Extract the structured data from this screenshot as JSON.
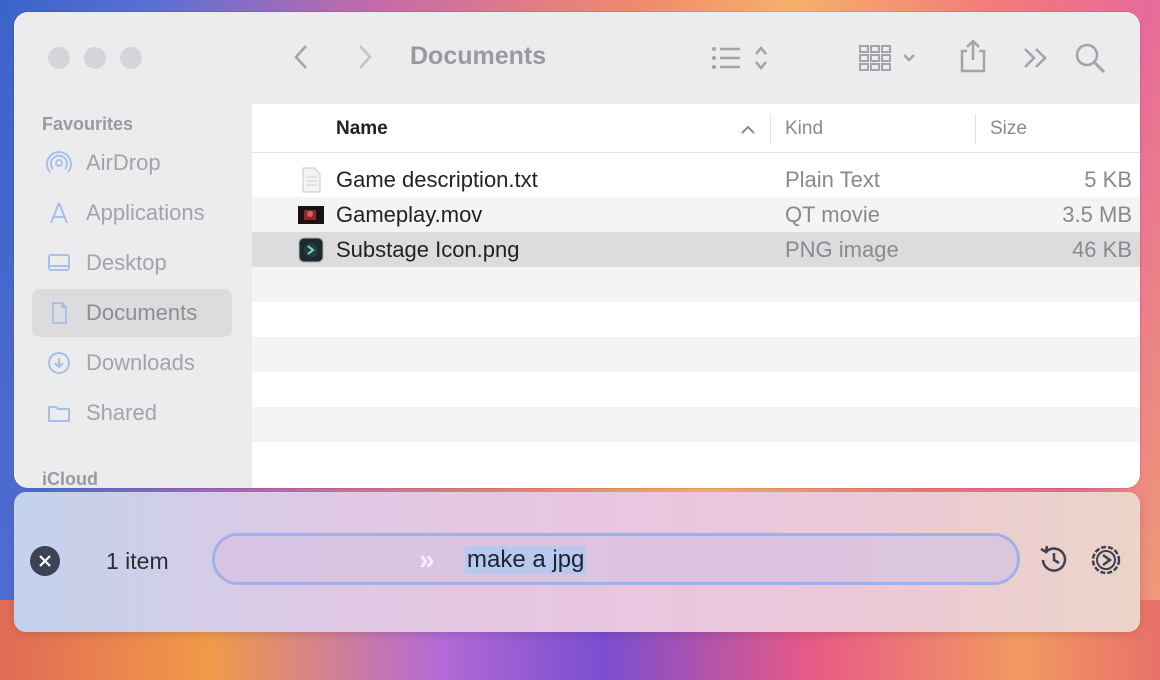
{
  "finder": {
    "title": "Documents",
    "sidebar": {
      "favourites_label": "Favourites",
      "items": [
        {
          "label": "AirDrop",
          "icon": "airdrop-icon"
        },
        {
          "label": "Applications",
          "icon": "applications-icon"
        },
        {
          "label": "Desktop",
          "icon": "desktop-icon"
        },
        {
          "label": "Documents",
          "icon": "document-icon",
          "active": true
        },
        {
          "label": "Downloads",
          "icon": "downloads-icon"
        },
        {
          "label": "Shared",
          "icon": "folder-icon"
        }
      ],
      "icloud_label": "iCloud"
    },
    "columns": {
      "name": "Name",
      "kind": "Kind",
      "size": "Size"
    },
    "files": [
      {
        "name": "Game description.txt",
        "kind": "Plain Text",
        "size": "5 KB",
        "icon": "text-file-icon"
      },
      {
        "name": "Gameplay.mov",
        "kind": "QT movie",
        "size": "3.5 MB",
        "icon": "movie-thumbnail-icon"
      },
      {
        "name": "Substage Icon.png",
        "kind": "PNG image",
        "size": "46 KB",
        "icon": "substage-png-icon",
        "selected": true
      }
    ]
  },
  "substage": {
    "item_count": "1 item",
    "command_text": "make a jpg",
    "icons": [
      "close-icon",
      "history-icon",
      "settings-icon"
    ]
  }
}
